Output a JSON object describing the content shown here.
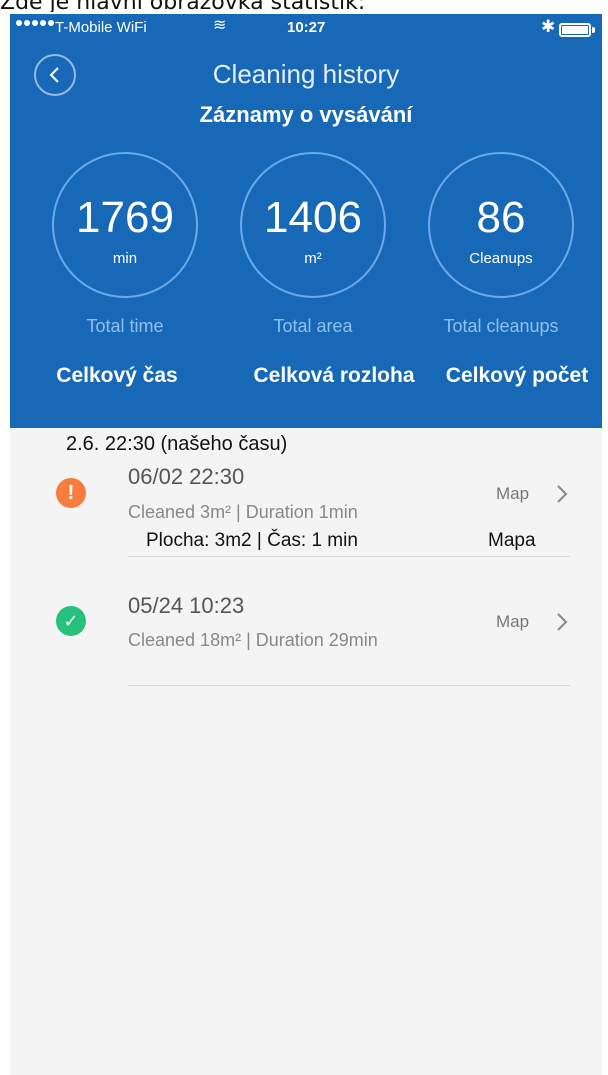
{
  "caption": "Zde je hlavní obrazovka statistik:",
  "status_bar": {
    "carrier": "T-Mobile WiFi",
    "time": "10:27",
    "icons": [
      "signal-dots",
      "wifi-icon",
      "bluetooth-icon",
      "battery-icon"
    ]
  },
  "header": {
    "title": "Cleaning history",
    "subtitle": "Záznamy o vysávání",
    "back_icon": "chevron-left-icon"
  },
  "stats": [
    {
      "value": "1769",
      "unit": "min",
      "label": "Total time",
      "label_cz": "Celkový čas"
    },
    {
      "value": "1406",
      "unit": "m²",
      "label": "Total area",
      "label_cz": "Celková rozloha"
    },
    {
      "value": "86",
      "unit": "Cleanups",
      "label": "Total cleanups",
      "label_cz": "Celkový počet"
    }
  ],
  "note": "2.6. 22:30 (našeho času)",
  "records": [
    {
      "date": "06/02 22:30",
      "detail": "Cleaned 3m²  |  Duration 1min",
      "detail_cz": "Plocha: 3m2 | Čas: 1 min",
      "map": "Map",
      "map_cz": "Mapa",
      "status": "warning",
      "status_glyph": "!"
    },
    {
      "date": "05/24 10:23",
      "detail": "Cleaned 18m²  |  Duration 29min",
      "map": "Map",
      "status": "success",
      "status_glyph": "✓"
    }
  ],
  "colors": {
    "header_bg": "#1769b7",
    "warning": "#f77d3e",
    "success": "#27c07c",
    "list_bg": "#f4f4f4"
  }
}
